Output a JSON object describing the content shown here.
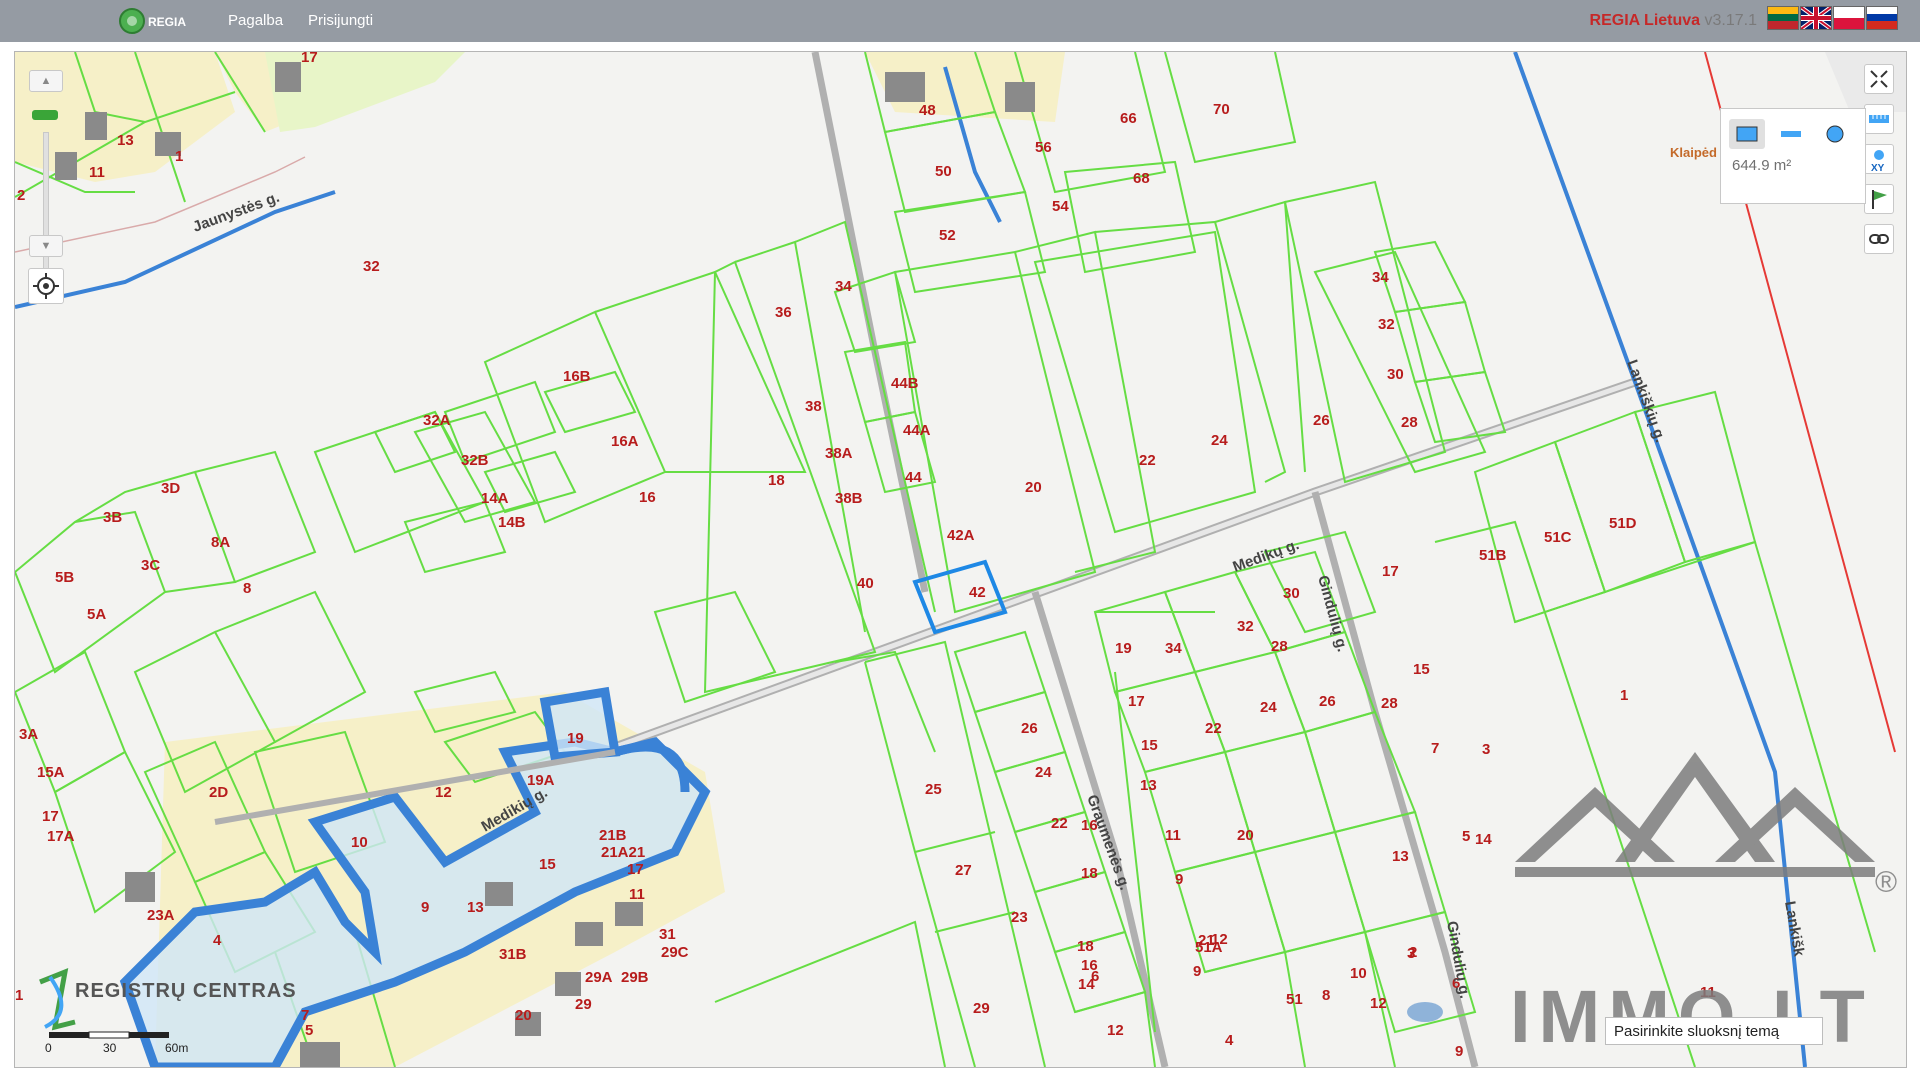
{
  "header": {
    "brand": "REGIA",
    "nav": [
      "Pagalba",
      "Prisijungti"
    ],
    "app_title": "REGIA Lietuva",
    "version": "v3.17.1",
    "flags": [
      "lt",
      "en",
      "pl",
      "ru"
    ]
  },
  "map": {
    "measure_value": "644.9 m²",
    "search_placeholder": "Pasirinkite sluoksnį temą",
    "scale": {
      "labels": [
        "0",
        "30",
        "60m"
      ]
    },
    "partial_label": "Klaipėd",
    "logos": {
      "registru": "REGISTRŲ CENTRAS",
      "immo": "IMMO.LT",
      "registered": "®"
    },
    "streets": [
      "Jaunystės g.",
      "Medikų g.",
      "Medikių g.",
      "Lankiškių g.",
      "Gindulių g.",
      "Graumenės g.",
      "Gindulių g.",
      "Lankišk"
    ],
    "parcels": [
      "17",
      "13",
      "11",
      "1",
      "2",
      "32",
      "48",
      "56",
      "66",
      "70",
      "50",
      "68",
      "54",
      "52",
      "34",
      "36",
      "16B",
      "32A",
      "16A",
      "32B",
      "38",
      "3D",
      "14A",
      "14B",
      "3B",
      "8A",
      "16",
      "18",
      "38A",
      "38B",
      "3C",
      "5B",
      "5A",
      "8",
      "44B",
      "44A",
      "44",
      "42A",
      "42",
      "40",
      "20",
      "22",
      "24",
      "26",
      "34",
      "32",
      "30",
      "28",
      "51B",
      "51C",
      "51D",
      "17",
      "30",
      "32",
      "34",
      "19",
      "28",
      "24",
      "26",
      "28",
      "17",
      "15",
      "15",
      "22",
      "26",
      "24",
      "22",
      "13",
      "16",
      "18",
      "3A",
      "15A",
      "17",
      "17A",
      "2D",
      "25",
      "20",
      "11",
      "14",
      "13",
      "9",
      "27",
      "7",
      "21",
      "9",
      "23A",
      "23",
      "4",
      "6",
      "10",
      "12",
      "19A",
      "19",
      "21B",
      "21A21",
      "17",
      "11",
      "15",
      "13",
      "9",
      "31B",
      "31",
      "29C",
      "29B",
      "29A",
      "29",
      "20",
      "1",
      "3",
      "5",
      "7",
      "27",
      "16",
      "14",
      "18",
      "12",
      "10",
      "31",
      "29",
      "8",
      "10",
      "12",
      "3",
      "6",
      "4",
      "2",
      "1",
      "5",
      "9",
      "7",
      "51",
      "12",
      "51A",
      "11",
      "2",
      "1",
      "3",
      "5"
    ]
  }
}
